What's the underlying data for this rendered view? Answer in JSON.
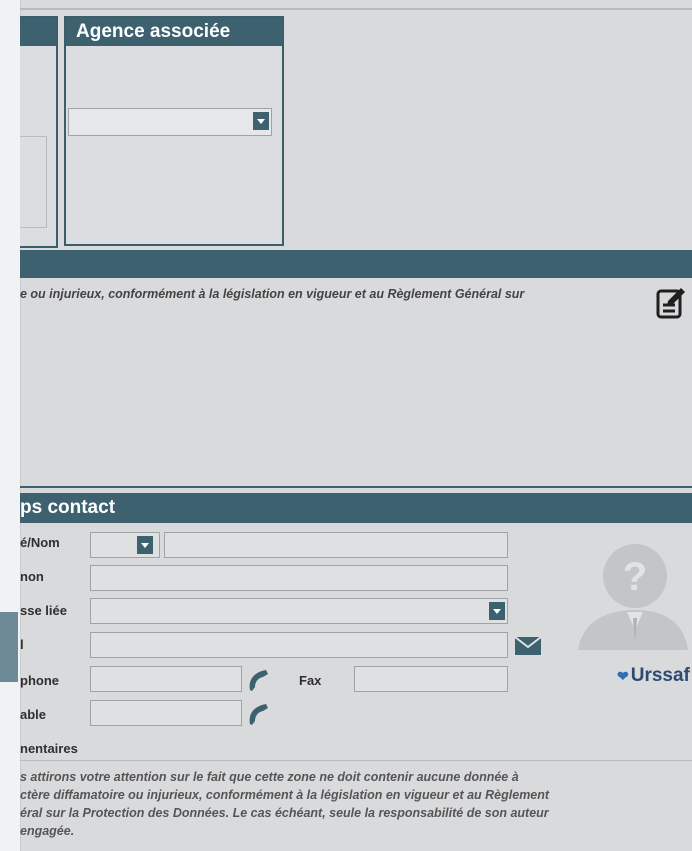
{
  "agence": {
    "title": "Agence associée",
    "selected": ""
  },
  "notice": {
    "text": "e ou injurieux, conformément à la législation en vigueur et au Règlement Général sur"
  },
  "contact": {
    "title": "ps contact",
    "fields": {
      "civilite_nom_label": "é/Nom",
      "civilite_value": "",
      "nom_value": "",
      "prenom_label": "non",
      "prenom_value": "",
      "adresse_label": "sse liée",
      "adresse_value": "",
      "email_label": "l",
      "email_value": "",
      "telephone_label": "phone",
      "telephone_value": "",
      "fax_label": "Fax",
      "fax_value": "",
      "portable_label": "able",
      "portable_value": ""
    },
    "brand": "Urssaf",
    "brand_mark": "❤"
  },
  "comments": {
    "label": "nentaires",
    "text_lines": [
      "s attirons votre attention sur le fait que cette zone ne doit contenir aucune donnée à",
      "ctère diffamatoire ou injurieux, conformément à la législation en vigueur et au Règlement",
      "éral sur la Protection des Données. Le cas échéant, seule la responsabilité de son auteur",
      "engagée."
    ]
  },
  "colors": {
    "header_bg": "#3e6170",
    "page_bg": "#d9dadc",
    "icon_color": "#3e6170"
  },
  "icons": [
    "edit-document-icon",
    "chevron-down-icon",
    "mail-icon",
    "phone-icon",
    "avatar-placeholder-icon"
  ]
}
